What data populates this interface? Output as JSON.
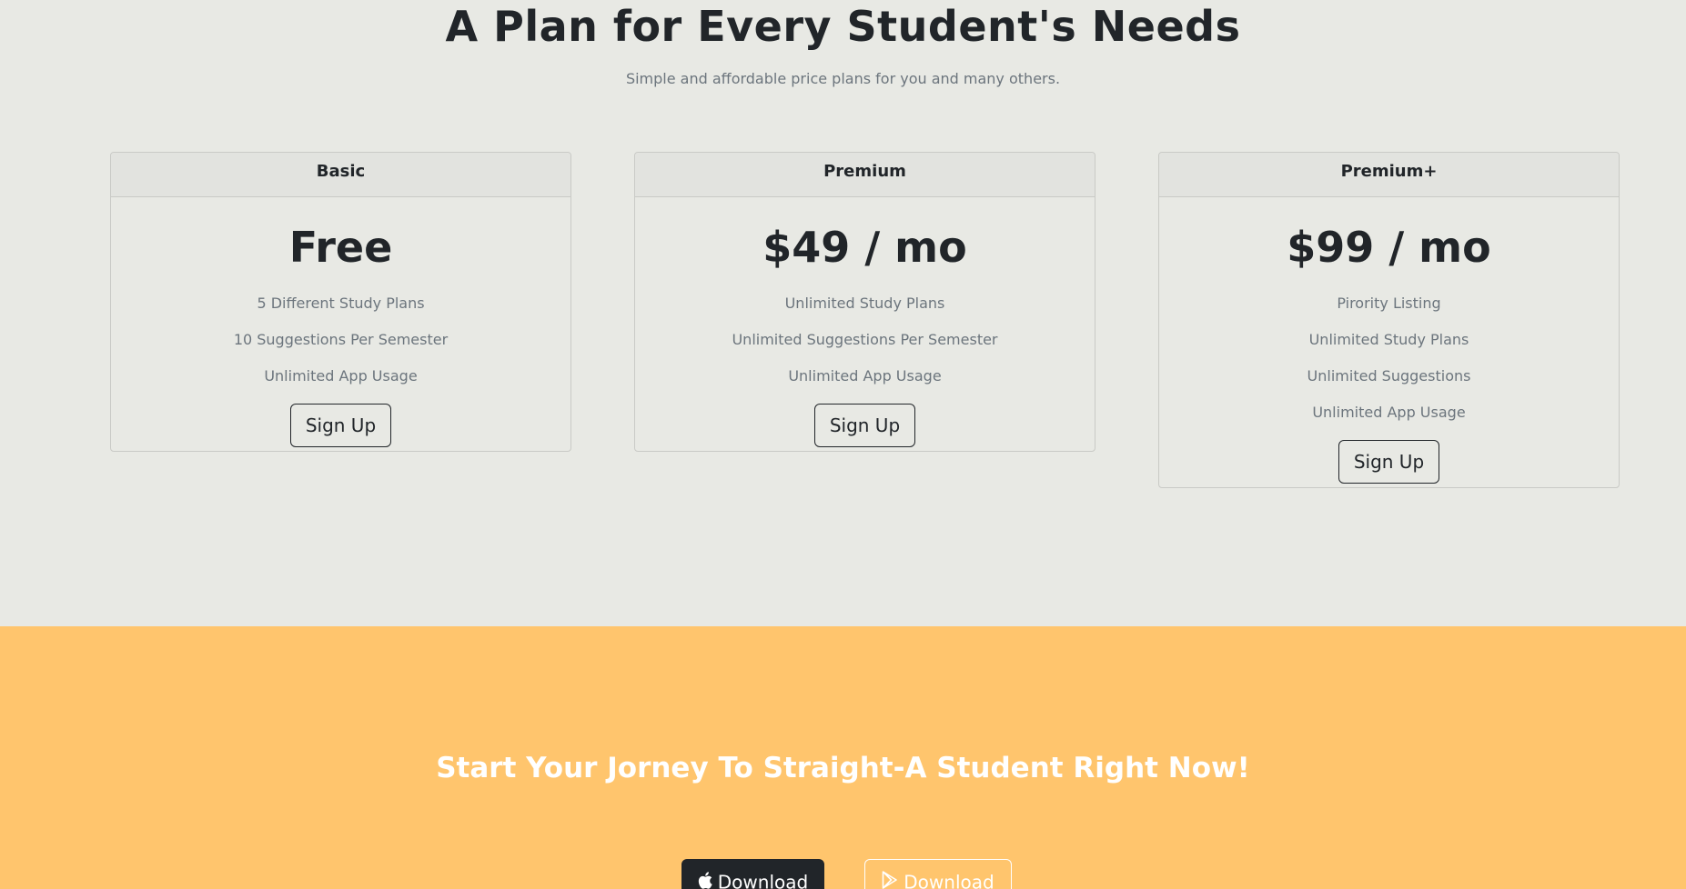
{
  "pricing": {
    "title": "A Plan for Every Student's Needs",
    "subtitle": "Simple and affordable price plans for you and many others.",
    "plans": [
      {
        "name": "Basic",
        "price": "Free",
        "features": [
          "5 Different Study Plans",
          "10 Suggestions Per Semester",
          "Unlimited App Usage"
        ],
        "button": "Sign Up"
      },
      {
        "name": "Premium",
        "price": "$49 / mo",
        "features": [
          "Unlimited Study Plans",
          "Unlimited Suggestions Per Semester",
          "Unlimited App Usage"
        ],
        "button": "Sign Up"
      },
      {
        "name": "Premium+",
        "price": "$99 / mo",
        "features": [
          "Pirority Listing",
          "Unlimited Study Plans",
          "Unlimited Suggestions",
          "Unlimited App Usage"
        ],
        "button": "Sign Up"
      }
    ]
  },
  "cta": {
    "title": "Start Your Jorney To Straight-A Student Right Now!",
    "apple_button": {
      "label": "Download",
      "icon": "apple-icon"
    },
    "play_button": {
      "label": "Download",
      "icon": "google-play-icon"
    }
  },
  "colors": {
    "background": "#e8e9e4",
    "accent": "#ffc56d",
    "dark": "#212529",
    "muted": "#6c757d"
  }
}
